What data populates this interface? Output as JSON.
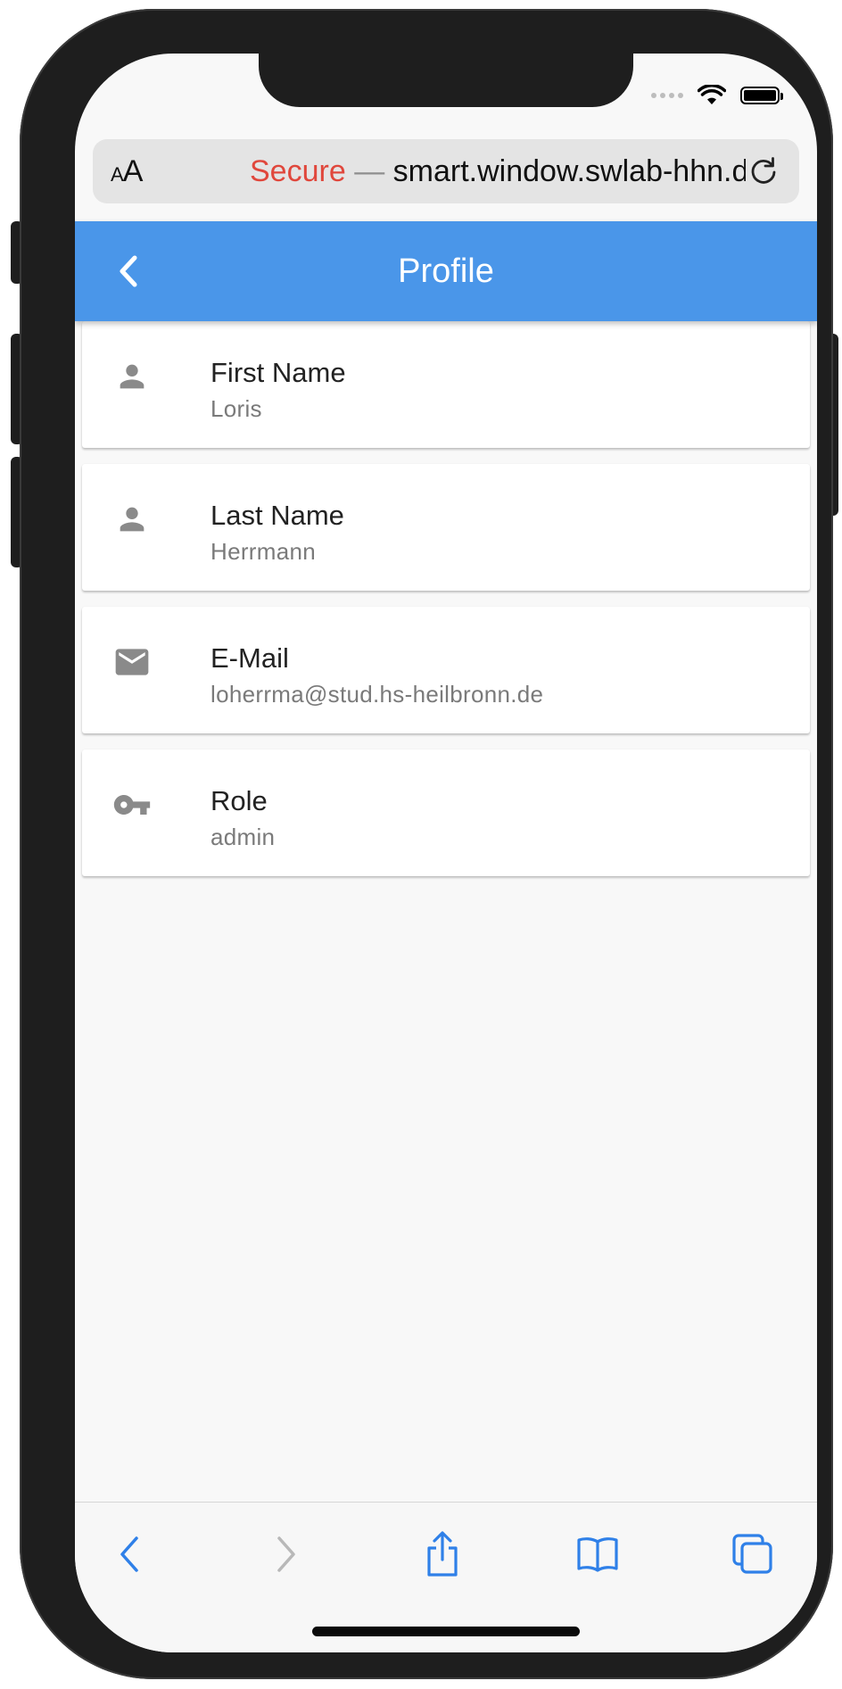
{
  "browser": {
    "text_size_label_small": "A",
    "text_size_label_large": "A",
    "secure_label": "Secure",
    "separator": "—",
    "url": "smart.window.swlab-hhn.de"
  },
  "header": {
    "title": "Profile",
    "color": "#4a96e9"
  },
  "profile_fields": [
    {
      "icon": "person-icon",
      "label": "First Name",
      "value": "Loris"
    },
    {
      "icon": "person-icon",
      "label": "Last Name",
      "value": "Herrmann"
    },
    {
      "icon": "email-icon",
      "label": "E-Mail",
      "value": "loherrma@stud.hs-heilbronn.de"
    },
    {
      "icon": "key-icon",
      "label": "Role",
      "value": "admin"
    }
  ],
  "toolbar": {
    "items": [
      "back-icon",
      "forward-icon",
      "share-icon",
      "bookmarks-icon",
      "tabs-icon"
    ],
    "accent": "#2f80e8"
  }
}
